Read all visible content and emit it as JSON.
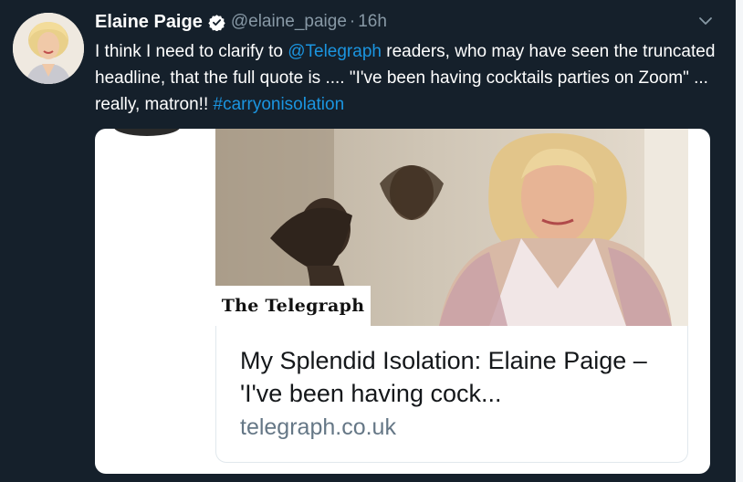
{
  "tweet": {
    "display_name": "Elaine Paige",
    "handle": "@elaine_paige",
    "separator": "·",
    "time": "16h",
    "text_before_mention": "I think I need to clarify to ",
    "mention": "@Telegraph",
    "text_after_mention": " readers, who may have seen the truncated headline, that the full quote is .... \"I've been having cocktails parties on Zoom\" ... really, matron!! ",
    "hashtag": "#carryonisolation"
  },
  "card": {
    "masthead": "The Telegraph",
    "title": "My Splendid Isolation: Elaine Paige – 'I've been having cock...",
    "domain": "telegraph.co.uk"
  },
  "icons": {
    "verified": "verified-badge-icon",
    "caret": "chevron-down-icon"
  },
  "colors": {
    "background": "#15202b",
    "link": "#1b95e0",
    "muted": "#8899a6",
    "verified": "#ffffff"
  }
}
